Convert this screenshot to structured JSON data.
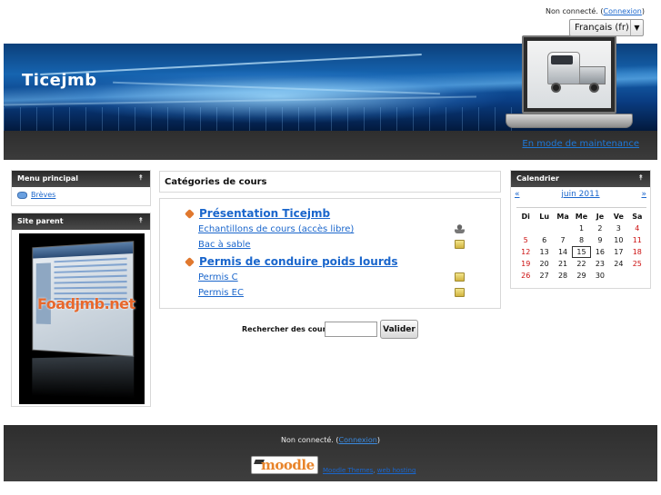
{
  "header": {
    "login_status": "Non connecté.",
    "login_link": "Connexion",
    "language": "Français (fr)",
    "site_title": "Ticejmb",
    "maintenance_link": "En mode de maintenance"
  },
  "menu_block": {
    "title": "Menu principal",
    "items": [
      {
        "label": "Brèves",
        "icon": "chat-icon"
      }
    ]
  },
  "parent_block": {
    "title": "Site parent",
    "image_brand": "Foadjmb.net"
  },
  "main": {
    "categories_title": "Catégories de cours",
    "categories": [
      {
        "name": "Présentation Ticejmb",
        "courses": [
          {
            "name": "Echantillons de cours (accès libre)",
            "icon": "guest-access-icon"
          },
          {
            "name": "Bac à sable",
            "icon": "enrolment-key-icon"
          }
        ]
      },
      {
        "name": "Permis de conduire poids lourds",
        "courses": [
          {
            "name": "Permis C",
            "icon": "enrolment-key-icon"
          },
          {
            "name": "Permis EC",
            "icon": "enrolment-key-icon"
          }
        ]
      }
    ],
    "search": {
      "label": "Rechercher des cours:",
      "value": "",
      "button": "Valider"
    }
  },
  "calendar": {
    "title": "Calendrier",
    "prev": "«",
    "next": "»",
    "month": "juin 2011",
    "weekdays": [
      "Di",
      "Lu",
      "Ma",
      "Me",
      "Je",
      "Ve",
      "Sa"
    ],
    "weeks": [
      [
        "",
        "",
        "",
        "1",
        "2",
        "3",
        "4"
      ],
      [
        "5",
        "6",
        "7",
        "8",
        "9",
        "10",
        "11"
      ],
      [
        "12",
        "13",
        "14",
        "15",
        "16",
        "17",
        "18"
      ],
      [
        "19",
        "20",
        "21",
        "22",
        "23",
        "24",
        "25"
      ],
      [
        "26",
        "27",
        "28",
        "29",
        "30",
        "",
        ""
      ]
    ],
    "today": "15",
    "weekend_color": "#cc1010"
  },
  "footer": {
    "login_status": "Non connecté.",
    "login_link": "Connexion",
    "logo_text": "moodle",
    "themes_link": "Moodle Themes",
    "hosting_link": "web hosting"
  }
}
